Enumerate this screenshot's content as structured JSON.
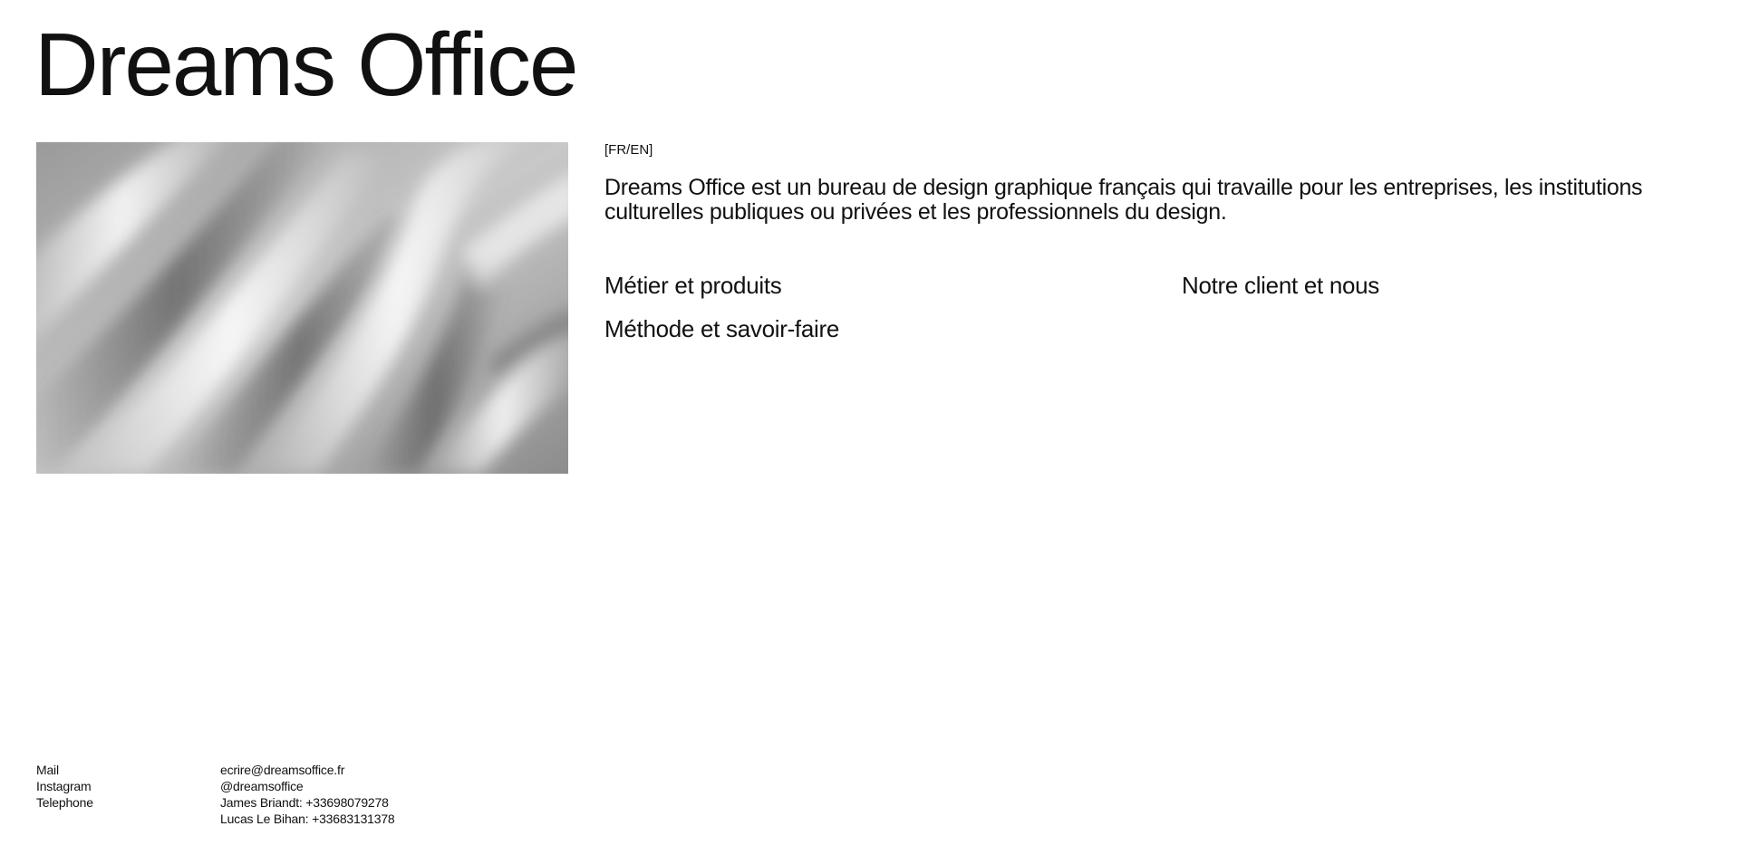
{
  "header": {
    "title": "Dreams Office"
  },
  "hero": {
    "image_description_icon": "silver-satin-fabric-image"
  },
  "main": {
    "lang_switch": "[FR/EN]",
    "intro": "Dreams Office est un bureau de design graphique français qui travaille pour les entreprises, les institutions culturelles publiques ou privées et les professionnels du design.",
    "nav": {
      "metier": "Métier et produits",
      "client": "Notre client et nous",
      "methode": "Méthode et savoir-faire"
    }
  },
  "footer": {
    "labels": {
      "mail": "Mail",
      "instagram": "Instagram",
      "telephone": "Telephone"
    },
    "values": {
      "mail": "ecrire@dreamsoffice.fr",
      "instagram": "@dreamsoffice",
      "phone_1": "James Briandt: +33698079278",
      "phone_2": "Lucas Le Bihan: +33683131378"
    }
  }
}
